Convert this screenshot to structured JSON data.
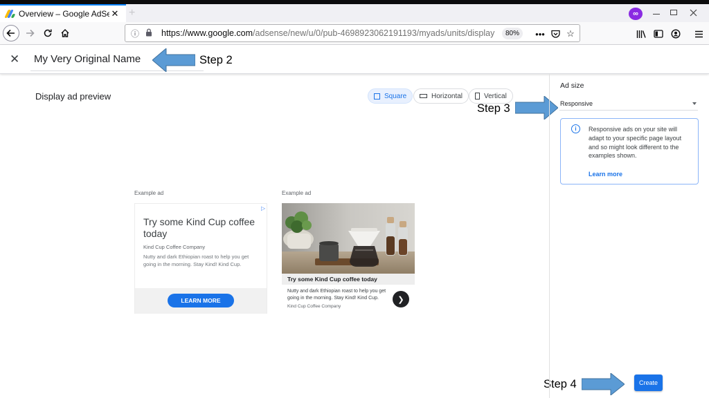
{
  "browser": {
    "tab_title": "Overview – Google AdSense",
    "tab_close": "✕",
    "new_tab": "+",
    "url_host": "https://www.google.com",
    "url_path": "/adsense/new/u/0/pub-4698923062191193/myads/units/display",
    "zoom": "80%",
    "mask_label": "∞"
  },
  "header": {
    "close_glyph": "✕",
    "ad_unit_name": "My Very Original Name"
  },
  "annotations": {
    "step2": "Step 2",
    "step3": "Step 3",
    "step4": "Step 4",
    "arrow_color": "#5b9bd5"
  },
  "main": {
    "preview_title": "Display ad preview",
    "chips": [
      {
        "label": "Square",
        "active": true
      },
      {
        "label": "Horizontal",
        "active": false
      },
      {
        "label": "Vertical",
        "active": false
      }
    ]
  },
  "ads": {
    "ad1": {
      "label": "Example ad",
      "headline": "Try some Kind Cup coffee today",
      "company": "Kind Cup Coffee Company",
      "description": "Nutty and dark Ethiopian roast to help you get going in the morning. Stay Kind! Kind Cup.",
      "cta": "LEARN MORE",
      "adchoices": "▷"
    },
    "ad2": {
      "label": "Example ad",
      "headline": "Try some Kind Cup coffee today",
      "description": "Nutty and dark Ethiopian roast to help you get going in the morning. Stay Kind! Kind Cup.",
      "company": "Kind Cup Coffee Company",
      "next": "❯"
    }
  },
  "panel": {
    "ad_size_label": "Ad size",
    "ad_size_value": "Responsive",
    "info_icon": "i",
    "info_text": "Responsive ads on your site will adapt to your specific page layout and so might look different to the examples shown.",
    "learn_more": "Learn more",
    "create_label": "Create"
  },
  "colors": {
    "accent": "#1a73e8",
    "firefox_tab_accent": "#0a84ff"
  }
}
